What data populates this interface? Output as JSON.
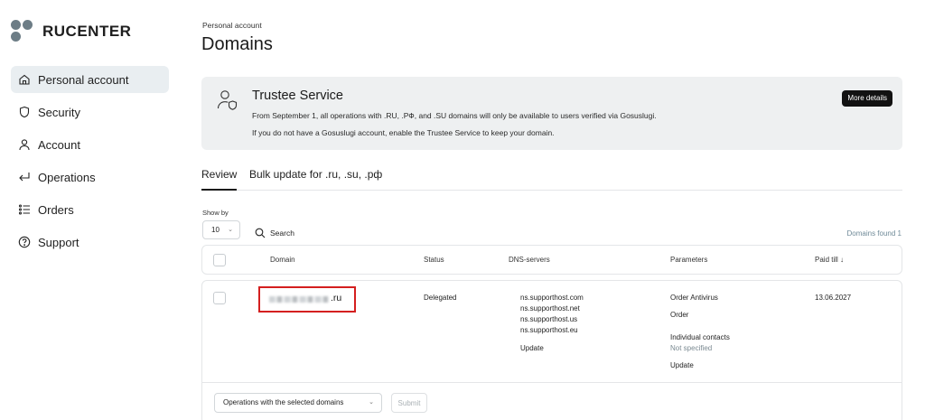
{
  "brand": {
    "name": "RUCENTER"
  },
  "sidebar": {
    "items": [
      {
        "label": "Personal account",
        "icon": "home-icon",
        "active": true
      },
      {
        "label": "Security",
        "icon": "shield-icon",
        "active": false
      },
      {
        "label": "Account",
        "icon": "user-icon",
        "active": false
      },
      {
        "label": "Operations",
        "icon": "return-arrow-icon",
        "active": false
      },
      {
        "label": "Orders",
        "icon": "list-icon",
        "active": false
      },
      {
        "label": "Support",
        "icon": "help-circle-icon",
        "active": false
      }
    ]
  },
  "header": {
    "breadcrumb": "Personal account",
    "title": "Domains"
  },
  "banner": {
    "title": "Trustee Service",
    "line1": "From September 1, all operations with .RU, .РФ, and .SU domains will only be available to users verified via Gosuslugi.",
    "line2": "If you do not have a Gosuslugi account, enable the Trustee Service to keep your domain.",
    "button_label": "More details"
  },
  "tabs": [
    {
      "label": "Review",
      "active": true
    },
    {
      "label": "Bulk update for .ru, .su, .рф",
      "active": false
    }
  ],
  "controls": {
    "show_by_label": "Show by",
    "show_by_value": "10",
    "search_label": "Search",
    "found_text": "Domains found 1"
  },
  "table": {
    "columns": [
      "Domain",
      "Status",
      "DNS-servers",
      "Parameters",
      "Paid till ↓"
    ],
    "rows": [
      {
        "domain_suffix": ".ru",
        "status": "Delegated",
        "dns": [
          "ns.supporthost.com",
          "ns.supporthost.net",
          "ns.supporthost.us",
          "ns.supporthost.eu"
        ],
        "dns_update": "Update",
        "param_antivirus": "Order Antivirus",
        "param_order": "Order",
        "param_contacts_label": "Individual contacts",
        "param_contacts_value": "Not specified",
        "param_update": "Update",
        "paid_till": "13.06.2027"
      }
    ]
  },
  "footer": {
    "bulk_placeholder": "Operations with the selected domains",
    "submit_label": "Submit"
  },
  "colors": {
    "accent_highlight": "#d41f1f",
    "active_nav_bg": "#e9eef1",
    "banner_bg": "#eef0f1"
  }
}
